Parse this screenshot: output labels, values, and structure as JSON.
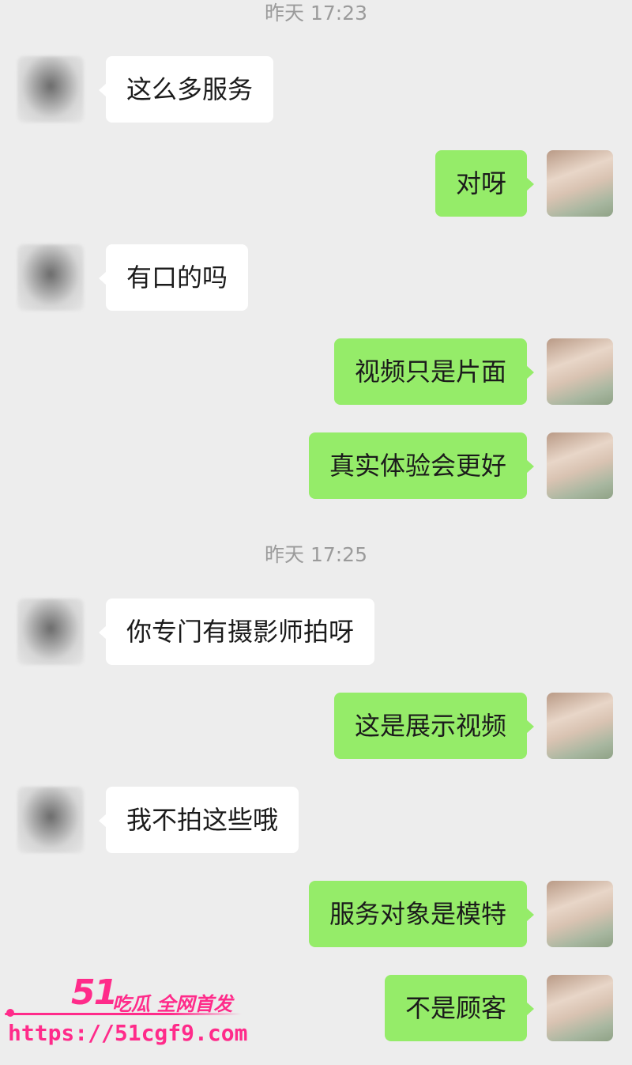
{
  "timestamps": [
    "昨天 17:23",
    "昨天 17:25"
  ],
  "messages": [
    {
      "side": "left",
      "text": "这么多服务"
    },
    {
      "side": "right",
      "text": "对呀"
    },
    {
      "side": "left",
      "text": "有口的吗"
    },
    {
      "side": "right",
      "text": "视频只是片面"
    },
    {
      "side": "right",
      "text": "真实体验会更好"
    },
    {
      "side": "left",
      "text": "你专门有摄影师拍呀"
    },
    {
      "side": "right",
      "text": "这是展示视频"
    },
    {
      "side": "left",
      "text": "我不拍这些哦"
    },
    {
      "side": "right",
      "text": "服务对象是模特"
    },
    {
      "side": "right",
      "text": "不是顾客"
    }
  ],
  "watermark": {
    "brand_number": "51",
    "brand_text": "吃瓜 全网首发",
    "url": "https://51cgf9.com",
    "color": "#ff2b8a"
  },
  "colors": {
    "background": "#ededed",
    "incoming_bubble": "#ffffff",
    "outgoing_bubble": "#95ec69",
    "timestamp": "#9b9b9b"
  },
  "icons": {
    "incoming_avatar": "blurred-avatar-icon",
    "outgoing_avatar": "photo-avatar-icon"
  }
}
